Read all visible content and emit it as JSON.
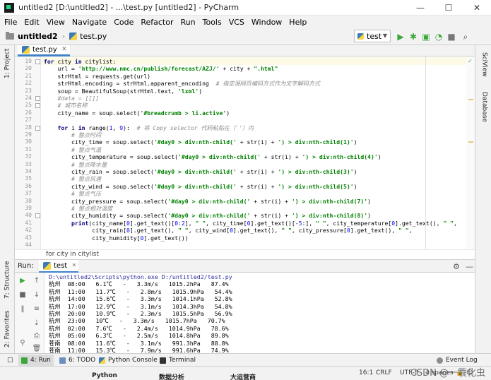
{
  "window": {
    "title": "untitled2 [D:\\untitled2] - ...\\test.py [untitled2] - PyCharm",
    "minimize": "—",
    "maximize": "☐",
    "close": "✕"
  },
  "menu": [
    "File",
    "Edit",
    "View",
    "Navigate",
    "Code",
    "Refactor",
    "Run",
    "Tools",
    "VCS",
    "Window",
    "Help"
  ],
  "nav": {
    "project": "untitled2",
    "file": "test.py",
    "run_config": "test"
  },
  "left_tools": {
    "project": "1: Project",
    "structure": "7: Structure",
    "favorites": "2: Favorites"
  },
  "right_tools": {
    "sciview": "SciView",
    "database": "Database"
  },
  "editor": {
    "tab": "test.py",
    "line_numbers": [
      "19",
      "20",
      "21",
      "22",
      "23",
      "24",
      "25",
      "26",
      "27",
      "28",
      "29",
      "30",
      "31",
      "32",
      "33",
      "34",
      "35",
      "36",
      "37",
      "38",
      "39",
      "40",
      "41",
      "42",
      "43",
      "44"
    ],
    "lines": [
      "for city in citylist:",
      "    url = 'http://www.nmc.cn/publish/forecast/AZJ/' + city + \".html\"",
      "    strHtml = requests.get(url)",
      "    strHtml.encoding = strHtml.apparent_encoding  # 指定源网页编码方式作为文字解码方式",
      "    soup = BeautifulSoup(strHtml.text, 'lxml')",
      "    #data = [[]]",
      "    # 城市名称",
      "    city_name = soup.select('#breadcrumb > li.active')",
      "",
      "    for i in range(1, 9):  # 将 Copy selector 代码粘贴在（''）内",
      "        # 整点时间",
      "        city_time = soup.select('#day0 > div:nth-child(' + str(i) + ') > div:nth-child(1)')",
      "        # 整点气温",
      "        city_temperature = soup.select('#day0 > div:nth-child(' + str(i) + ') > div:nth-child(4)')",
      "        # 整点降水量",
      "        city_rain = soup.select('#day0 > div:nth-child(' + str(i) + ') > div:nth-child(3)')",
      "        # 整点风速",
      "        city_wind = soup.select('#day0 > div:nth-child(' + str(i) + ') > div:nth-child(5)')",
      "        # 整点气压",
      "        city_pressure = soup.select('#day0 > div:nth-child(' + str(i) + ') > div:nth-child(7)')",
      "        # 整点相对湿度",
      "        city_humidity = soup.select('#day0 > div:nth-child(' + str(i) + ') > div:nth-child(8)')",
      "        print(city_name[0].get_text()[0:2], \" \", city_time[0].get_text()[-5:], \" \", city_temperature[0].get_text(), \" \",",
      "              city_rain[0].get_text(), \" \", city_wind[0].get_text(), \" \", city_pressure[0].get_text(), \" \",",
      "              city_humidity[0].get_text())",
      ""
    ],
    "breadcrumb": "for city in citylist"
  },
  "run": {
    "label": "Run:",
    "tab": "test",
    "command": "D:\\untitled2\\Scripts\\python.exe D:/untitled2/test.py",
    "output": [
      "杭州  08:00   6.1℃   -   3.3m/s   1015.2hPa   87.4%",
      "杭州  11:00   11.7℃   -   2.8m/s   1015.9hPa   54.4%",
      "杭州  14:00   15.6℃   -   3.3m/s   1014.1hPa   52.8%",
      "杭州  17:00   12.9℃   -   3.1m/s   1014.3hPa   54.8%",
      "杭州  20:00   10.9℃   -   2.3m/s   1015.5hPa   56.9%",
      "杭州  23:00   10℃   -   3.3m/s   1015.7hPa   70.7%",
      "杭州  02:00   7.6℃   -   2.4m/s   1014.9hPa   78.6%",
      "杭州  05:00   6.3℃   -   2.5m/s   1014.8hPa   89.8%",
      "苍南  08:00   11.6℃   -   3.1m/s   991.3hPa   88.8%",
      "苍南  11:00   15.3℃   -   7.9m/s   991.6hPa   74.9%"
    ]
  },
  "bottom_tabs": {
    "run": "4: Run",
    "todo": "6: TODO",
    "console": "Python Console",
    "terminal": "Terminal",
    "event_log": "Event Log"
  },
  "status": {
    "position": "16:1",
    "line_sep": "CRLF",
    "encoding": "UTF-8",
    "indent": "4 spaces"
  },
  "overlay": {
    "python": "Python",
    "analysis": "数据分析",
    "bigdata": "大运营商"
  },
  "watermark": "CSDN @一蓑化虫",
  "colors": {
    "accent": "#4083c9",
    "run_green": "#3aa73a",
    "keyword": "#000080",
    "string": "#008000"
  }
}
